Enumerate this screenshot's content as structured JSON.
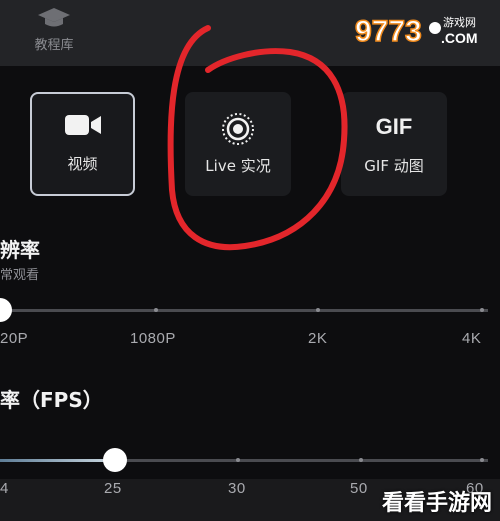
{
  "header": {
    "tab_tutorial_label": "教程库",
    "logo_text": "9773",
    "logo_site": "游戏网",
    "logo_com": ".COM"
  },
  "modes": [
    {
      "label": "视频",
      "icon": "video-camera-icon",
      "selected": true
    },
    {
      "label": "Live 实况",
      "icon": "live-photo-icon",
      "selected": false
    },
    {
      "label": "GIF 动图",
      "icon_text": "GIF",
      "selected": false
    }
  ],
  "resolution": {
    "title": "辨率",
    "subtitle": "常观看",
    "ticks": [
      "20P",
      "1080P",
      "2K",
      "4K"
    ],
    "selected_index": 0
  },
  "framerate": {
    "title": "率（FPS）",
    "ticks": [
      "4",
      "25",
      "30",
      "50",
      "60"
    ],
    "selected_value": "25"
  },
  "watermark": "看看手游网",
  "colors": {
    "annotation": "#e3262b",
    "background": "#0d0d0f",
    "card": "#1b1c1f",
    "slider_fill": "#c9d6df"
  }
}
